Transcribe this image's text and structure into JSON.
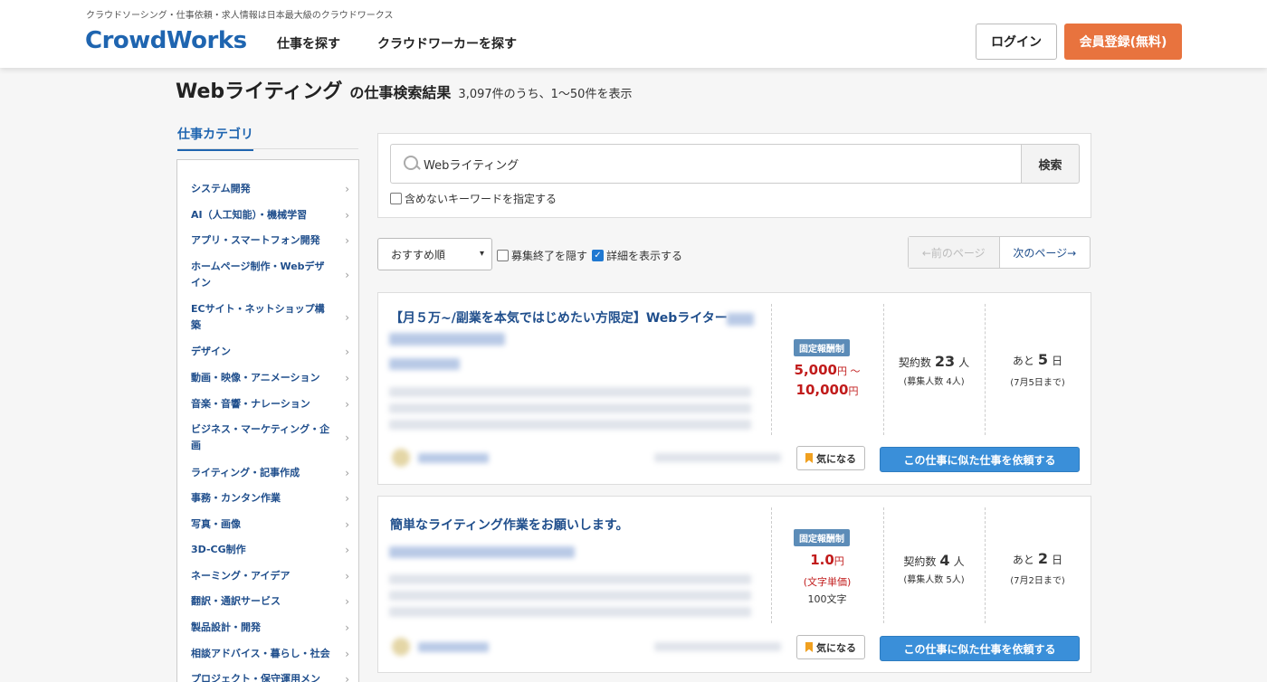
{
  "header": {
    "tagline": "クラウドソーシング・仕事依頼・求人情報は日本最大級のクラウドワークス",
    "logo": "CrowdWorks",
    "nav": [
      "仕事を探す",
      "クラウドワーカーを探す"
    ],
    "login": "ログイン",
    "register": "会員登録(無料)"
  },
  "page": {
    "keyword": "Webライティング",
    "suffix": "の仕事検索結果",
    "count": "3,097件のうち、1〜50件を表示"
  },
  "sidebar": {
    "heading": "仕事カテゴリ",
    "items": [
      "システム開発",
      "AI（人工知能）・機械学習",
      "アプリ・スマートフォン開発",
      "ホームページ制作・Webデザイン",
      "ECサイト・ネットショップ構築",
      "デザイン",
      "動画・映像・アニメーション",
      "音楽・音響・ナレーション",
      "ビジネス・マーケティング・企画",
      "ライティング・記事作成",
      "事務・カンタン作業",
      "写真・画像",
      "3D-CG制作",
      "ネーミング・アイデア",
      "翻訳・通訳サービス",
      "製品設計・開発",
      "相談アドバイス・暮らし・社会",
      "プロジェクト・保守運用メン"
    ]
  },
  "search": {
    "value": "Webライティング",
    "button": "検索",
    "exclude_label": "含めないキーワードを指定する"
  },
  "toolbar": {
    "sort_value": "おすすめ順",
    "hide_closed": "募集終了を隠す",
    "show_details": "詳細を表示する",
    "prev": "←前のページ",
    "next": "次のページ→"
  },
  "jobs": [
    {
      "title": "【月５万~/副業を本気ではじめたい方限定】Webライター",
      "badge": "固定報酬制",
      "price_line1": "5,000",
      "price_line1_unit": "円 〜",
      "price_line2": "10,000",
      "price_line2_unit": "円",
      "contracts_label": "契約数",
      "contracts": "23",
      "contracts_unit": "人",
      "recruit": "(募集人数 4人)",
      "remaining_label": "あと",
      "remaining": "5",
      "remaining_unit": "日",
      "deadline": "(7月5日まで)",
      "fav": "気になる",
      "order": "この仕事に似た仕事を依頼する"
    },
    {
      "title": "簡単なライティング作業をお願いします。",
      "badge": "固定報酬制",
      "price_line1": "1.0",
      "price_line1_unit": "円",
      "price_note": "(文字単価)",
      "price_qty": "100文字",
      "contracts_label": "契約数",
      "contracts": "4",
      "contracts_unit": "人",
      "recruit": "(募集人数 5人)",
      "remaining_label": "あと",
      "remaining": "2",
      "remaining_unit": "日",
      "deadline": "(7月2日まで)",
      "fav": "気になる",
      "order": "この仕事に似た仕事を依頼する"
    }
  ]
}
